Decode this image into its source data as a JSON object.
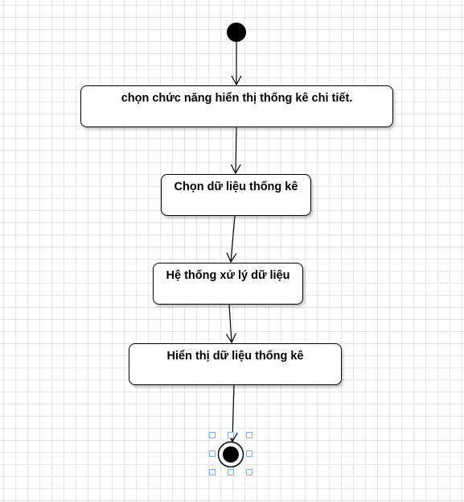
{
  "diagram": {
    "nodes": [
      {
        "id": "n1",
        "label": "chọn chức năng hiển thị thống kê chi tiết."
      },
      {
        "id": "n2",
        "label": "Chọn dữ liệu thống kê"
      },
      {
        "id": "n3",
        "label": "Hệ thống xử lý dữ liệu"
      },
      {
        "id": "n4",
        "label": "Hiển thị dữ liệu thống kê"
      }
    ],
    "colors": {
      "stroke": "#000000",
      "grid": "#e4e4e4",
      "selection": "#7ab0ef"
    }
  }
}
